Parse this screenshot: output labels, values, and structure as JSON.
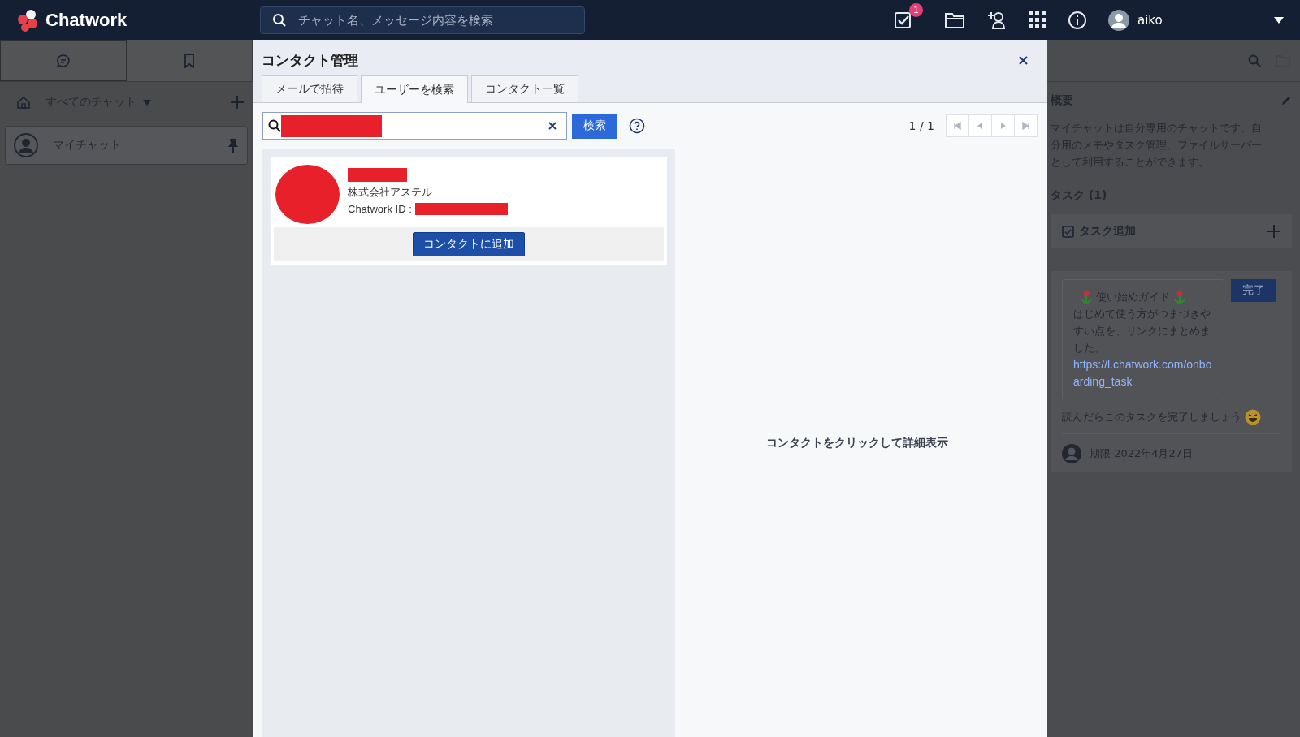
{
  "header": {
    "app_name": "Chatwork",
    "search_placeholder": "チャット名、メッセージ内容を検索",
    "task_badge": "1",
    "user_name": "aiko"
  },
  "sidebar": {
    "filter_label": "すべてのチャット",
    "rooms": [
      {
        "name": "マイチャット",
        "selected": true
      }
    ]
  },
  "dialog": {
    "title": "コンタクト管理",
    "tabs": [
      {
        "label": "メールで招待",
        "selected": false
      },
      {
        "label": "ユーザーを検索",
        "selected": true
      },
      {
        "label": "コンタクト一覧",
        "selected": false
      }
    ],
    "search_button": "検索",
    "pagination": "1 / 1",
    "results": [
      {
        "company": "株式会社アステル",
        "id_label": "Chatwork ID :",
        "add_button": "コンタクトに追加"
      }
    ],
    "detail_hint": "コンタクトをクリックして詳細表示"
  },
  "right_panel": {
    "summary_title": "概要",
    "summary_text": "マイチャットは自分専用のチャットです。自分用のメモやタスク管理、ファイルサーバーとして利用することができます。",
    "tasks_title": "タスク (1)",
    "add_task": "タスク追加",
    "tasks": [
      {
        "guide_title": "使い始めガイド",
        "body": "はじめて使う方がつまづきやすい点を、リンクにまとめました。",
        "link": "https://l.chatwork.com/onboarding_task",
        "footer": "読んだらこのタスクを完了しましょう",
        "done_button": "完了",
        "due": "期限 2022年4月27日"
      }
    ]
  }
}
